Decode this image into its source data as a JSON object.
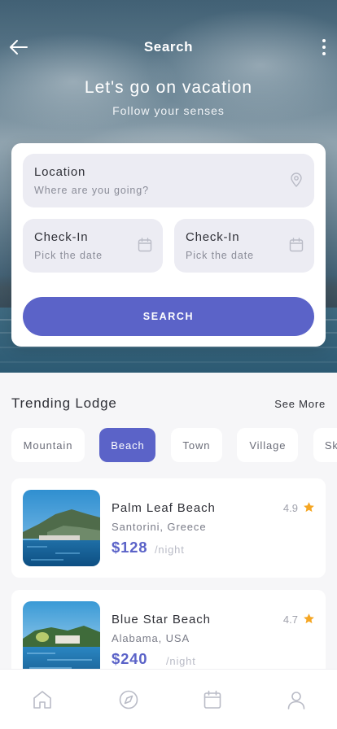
{
  "header": {
    "title": "Search",
    "back_icon": "arrow-left-icon",
    "menu_icon": "more-vertical-icon"
  },
  "hero": {
    "title": "Let's go on vacation",
    "subtitle": "Follow your senses"
  },
  "search_form": {
    "location": {
      "label": "Location",
      "placeholder": "Where are you going?",
      "icon": "map-pin-icon"
    },
    "check_in_1": {
      "label": "Check-In",
      "placeholder": "Pick the date",
      "icon": "calendar-icon"
    },
    "check_in_2": {
      "label": "Check-In",
      "placeholder": "Pick the date",
      "icon": "calendar-icon"
    },
    "submit_label": "SEARCH"
  },
  "trending": {
    "title": "Trending Lodge",
    "see_more": "See More",
    "categories": [
      {
        "label": "Mountain",
        "active": false
      },
      {
        "label": "Beach",
        "active": true
      },
      {
        "label": "Town",
        "active": false
      },
      {
        "label": "Village",
        "active": false
      },
      {
        "label": "Sky T",
        "active": false
      }
    ],
    "lodges": [
      {
        "name": "Palm Leaf Beach",
        "location": "Santorini, Greece",
        "price": "$128",
        "unit": "/night",
        "rating": "4.9"
      },
      {
        "name": "Blue Star Beach",
        "location": "Alabama, USA",
        "price": "$240",
        "unit": "/night",
        "rating": "4.7"
      }
    ]
  },
  "bottom_nav": {
    "items": [
      {
        "icon": "home-icon"
      },
      {
        "icon": "compass-icon"
      },
      {
        "icon": "calendar-icon"
      },
      {
        "icon": "user-icon"
      }
    ]
  },
  "colors": {
    "accent": "#5b63c8",
    "star": "#f5a623",
    "field_bg": "#ececf3"
  }
}
